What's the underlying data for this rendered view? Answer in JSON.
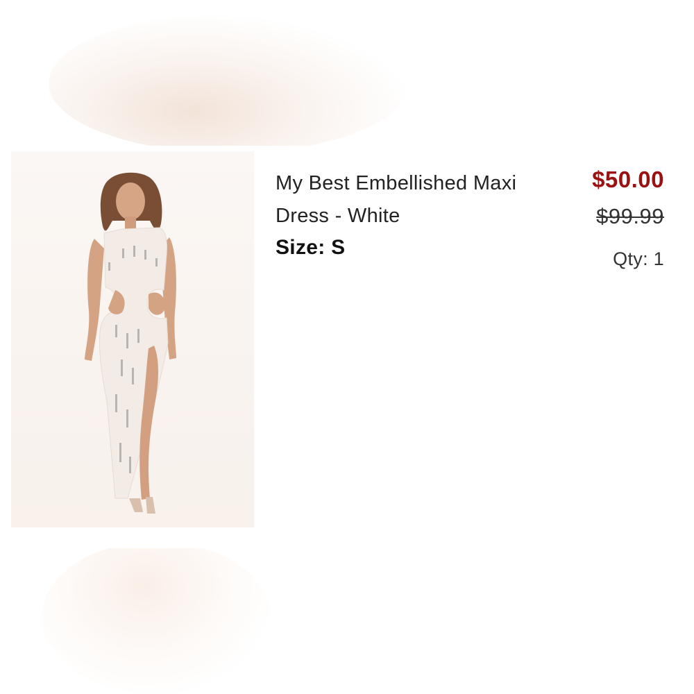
{
  "product": {
    "title": "My Best Embellished Maxi Dress - White",
    "size_text": "Size: S",
    "sale_price": "$50.00",
    "original_price": "$99.99",
    "quantity_text": "Qty: 1",
    "image_icon": "product-photo"
  },
  "colors": {
    "sale_price": "#9b1212",
    "text": "#222222",
    "background": "#ffffff"
  }
}
